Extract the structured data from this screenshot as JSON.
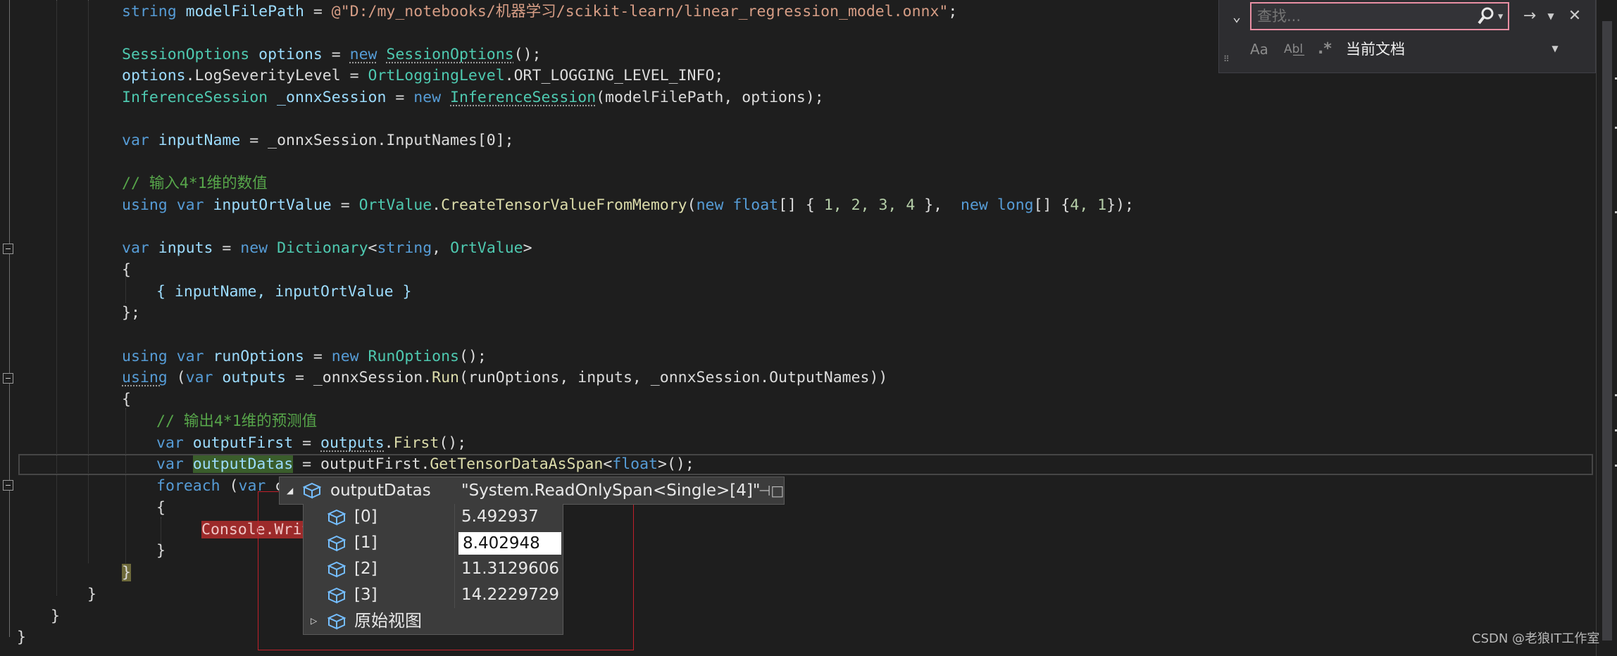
{
  "code": {
    "l0_type": "string",
    "l0_var": "modelFilePath",
    "l0_eq": " = ",
    "l0_str": "@\"D:/my_notebooks/机器学习/scikit-learn/linear_regression_model.onnx\"",
    "l0_end": ";",
    "l1_type": "SessionOptions",
    "l1_var": " options",
    "l1_eq": " = ",
    "l1_new": "new",
    "l1_ctor": "SessionOptions",
    "l1_end": "();",
    "l2_a": "options",
    "l2_b": ".LogSeverityLevel = ",
    "l2_c": "OrtLoggingLevel",
    "l2_d": ".ORT_LOGGING_LEVEL_INFO;",
    "l3_type": "InferenceSession",
    "l3_var": " _onnxSession",
    "l3_eq": " = ",
    "l3_new": "new",
    "l3_ctor": "InferenceSession",
    "l3_args": "(modelFilePath, options);",
    "l4_kw": "var",
    "l4_var": " inputName",
    "l4_rest": " = _onnxSession.InputNames[0];",
    "l5_comment": "// 输入4*1维的数值",
    "l6_using": "using",
    "l6_var": "var",
    "l6_name": " inputOrtValue",
    "l6_eq": " = ",
    "l6_type": "OrtValue",
    "l6_dot": ".",
    "l6_method": "CreateTensorValueFromMemory",
    "l6_p1": "(",
    "l6_new1": "new",
    "l6_float": "float",
    "l6_arr": "[] { ",
    "l6_nums": "1, 2, 3, 4",
    "l6_p2": " },  ",
    "l6_new2": "new",
    "l6_long": "long",
    "l6_arr2": "[] {",
    "l6_nums2": "4, 1",
    "l6_end": "});",
    "l7_kw": "var",
    "l7_var": " inputs",
    "l7_eq": " = ",
    "l7_new": "new",
    "l7_type": "Dictionary",
    "l7_lt": "<",
    "l7_str": "string",
    "l7_comma": ", ",
    "l7_ov": "OrtValue",
    "l7_gt": ">",
    "l8": "{",
    "l9": "{ inputName, inputOrtValue }",
    "l10": "};",
    "l11_using": "using",
    "l11_var": " var",
    "l11_name": " runOptions",
    "l11_eq": " = ",
    "l11_new": "new",
    "l11_type": "RunOptions",
    "l11_end": "();",
    "l12_using": "using",
    "l12_p": " (",
    "l12_var": "var",
    "l12_name": " outputs",
    "l12_eq": " = _onnxSession.",
    "l12_method": "Run",
    "l12_args": "(runOptions, inputs, _onnxSession.OutputNames))",
    "l13": "{",
    "l14_comment": "// 输出4*1维的预测值",
    "l15_kw": "var",
    "l15_name": " outputFirst",
    "l15_eq": " = ",
    "l15_a": "outputs",
    "l15_dot": ".",
    "l15_method": "First",
    "l15_end": "();",
    "l16_kw": "var",
    "l16_sp": " ",
    "l16_name": "outputDatas",
    "l16_eq": " = outputFirst.",
    "l16_method": "GetTensorDataAsSpan",
    "l16_lt": "<",
    "l16_type": "float",
    "l16_end": ">();",
    "l17_kw": "foreach",
    "l17_rest": " (",
    "l17_var": "var",
    "l17_tail": " c",
    "l18": "{",
    "l19": "Console.Writ",
    "l20": "}",
    "l21": "}",
    "l22": "}",
    "l23": "}",
    "l24": "}"
  },
  "find": {
    "placeholder": "查找...",
    "value": "",
    "next_icon": "→",
    "close_icon": "✕",
    "match_case": "Aa",
    "whole_word": "Ab̲l̲",
    "regex": ".*",
    "scope": "当前文档"
  },
  "datatip": {
    "name": "outputDatas",
    "value": "\"System.ReadOnlySpan<Single>[4]\"",
    "items": [
      {
        "name": "[0]",
        "value": "5.492937"
      },
      {
        "name": "[1]",
        "value": "8.402948"
      },
      {
        "name": "[2]",
        "value": "11.3129606"
      },
      {
        "name": "[3]",
        "value": "14.2229729"
      }
    ],
    "raw_view": "原始视图"
  },
  "watermark": "CSDN @老狼IT工作室"
}
